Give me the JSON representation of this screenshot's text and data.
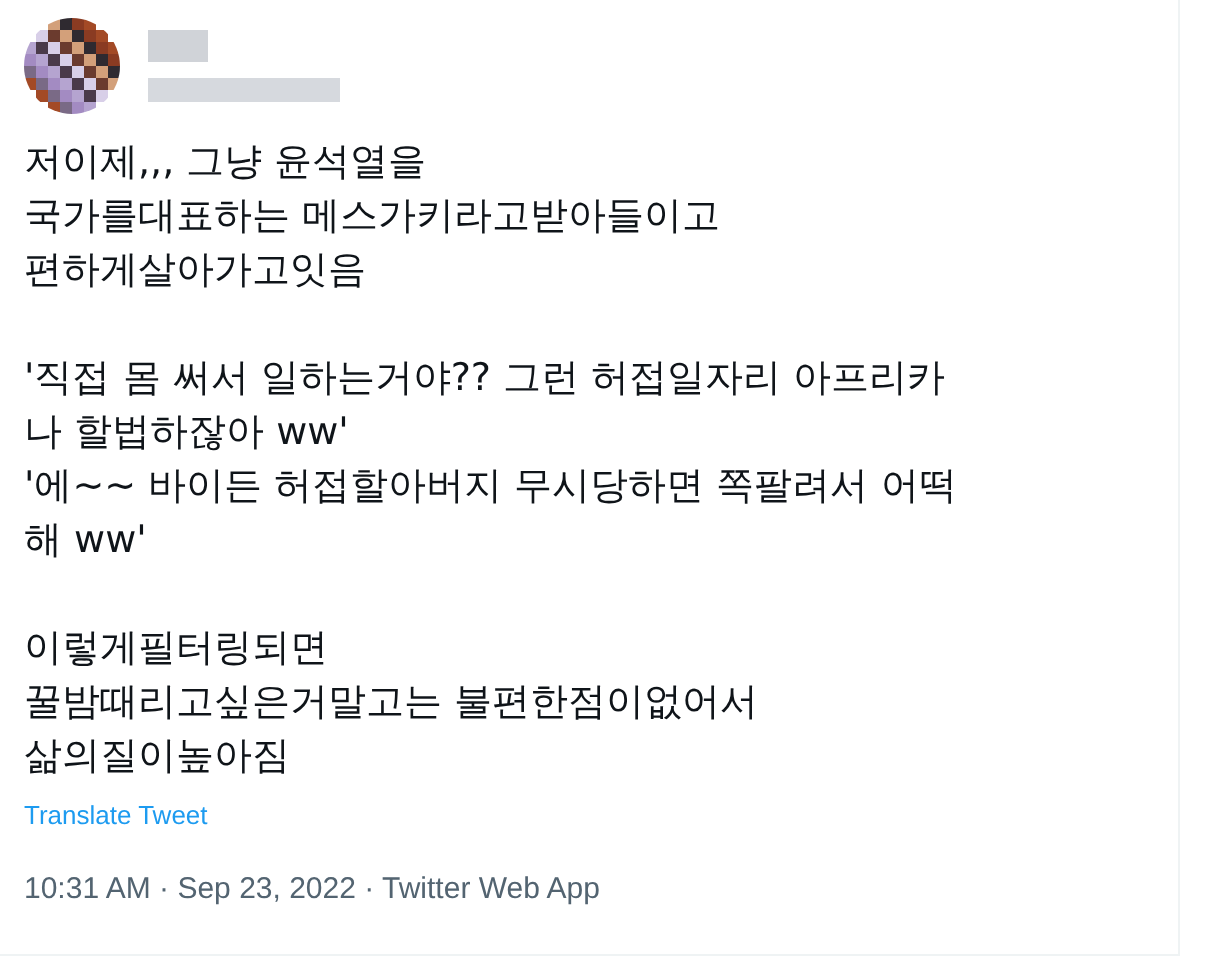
{
  "tweet": {
    "paragraphs": [
      [
        "저이제,,, 그냥 윤석열을",
        "국가를대표하는 메스가키라고받아들이고",
        "편하게살아가고잇음"
      ],
      [
        "'직접 몸 써서 일하는거야?? 그런 허접일자리 아프리카",
        "나 할법하잖아 ww'",
        "'에~~ 바이든 허접할아버지 무시당하면 쪽팔려서 어떡",
        "해 ww'"
      ],
      [
        "이렇게필터링되면",
        "꿀밤때리고싶은거말고는 불편한점이없어서",
        "삶의질이높아짐"
      ]
    ],
    "translate_link": "Translate Tweet",
    "timestamp": "10:31 AM · Sep 23, 2022 · Twitter Web App"
  }
}
